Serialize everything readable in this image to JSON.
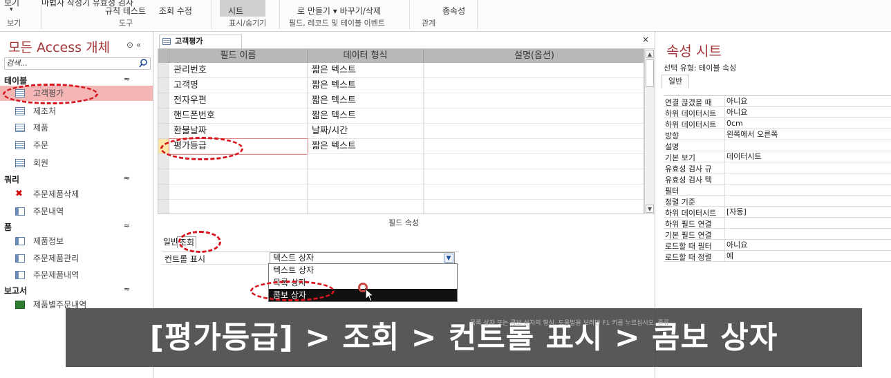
{
  "ribbon": {
    "row1": [
      "보기",
      "마법사 작성기 유효성 검사",
      "규칙 테스트",
      "조회 수정",
      "시트",
      "로 만들기 ▾ 바꾸기/삭제",
      "종속성"
    ],
    "row2_small": [
      "▾"
    ],
    "groups": [
      "보기",
      "도구",
      "표시/숨기기",
      "필드, 레코드 및 테이블 이벤트",
      "관계"
    ]
  },
  "nav": {
    "title": "모든 Access 개체",
    "title_buttons": "⊙ «",
    "search_placeholder": "검색...",
    "sections": {
      "tables": {
        "label": "테이블",
        "items": [
          "고객평가",
          "제조처",
          "제품",
          "주문",
          "회원"
        ]
      },
      "queries": {
        "label": "쿼리",
        "items": [
          "주문제품삭제",
          "주문내역"
        ]
      },
      "forms": {
        "label": "폼",
        "items": [
          "제품정보",
          "주문제품관리",
          "주문제품내역"
        ]
      },
      "reports": {
        "label": "보고서",
        "items": [
          "제품별주문내역"
        ]
      }
    },
    "collapse_glyph": "≈"
  },
  "document": {
    "tab_label": "고객평가",
    "close_glyph": "×",
    "columns": [
      "필드 이름",
      "데이터 형식",
      "설명(옵션)"
    ],
    "rows": [
      {
        "name": "관리번호",
        "type": "짧은 텍스트"
      },
      {
        "name": "고객명",
        "type": "짧은 텍스트"
      },
      {
        "name": "전자우편",
        "type": "짧은 텍스트"
      },
      {
        "name": "핸드폰번호",
        "type": "짧은 텍스트"
      },
      {
        "name": "환불날짜",
        "type": "날짜/시간"
      },
      {
        "name": "평가등급",
        "type": "짧은 텍스트"
      }
    ],
    "field_props_label": "필드 속성",
    "tabs": {
      "general": "일반",
      "lookup": "조회"
    },
    "lookup": {
      "control_label": "컨트롤 표시",
      "value": "텍스트 상자"
    },
    "dropdown_options": [
      "텍스트 상자",
      "목록 상자",
      "콤보 상자"
    ],
    "dropdown_highlight_index": 2
  },
  "property_sheet": {
    "title": "속성 시트",
    "selection_type": "선택 유형: 테이블 속성",
    "tab": "일반",
    "rows": [
      {
        "k": "연결 끊겼을 때",
        "v": "아니요"
      },
      {
        "k": "하위 데이터시트",
        "v": "아니요"
      },
      {
        "k": "하위 데이터시트",
        "v": "0cm"
      },
      {
        "k": "방향",
        "v": "왼쪽에서 오른쪽"
      },
      {
        "k": "설명",
        "v": ""
      },
      {
        "k": "기본 보기",
        "v": "데이터시트"
      },
      {
        "k": "유효성 검사 규",
        "v": ""
      },
      {
        "k": "유효성 검사 텍",
        "v": ""
      },
      {
        "k": "필터",
        "v": ""
      },
      {
        "k": "정렬 기준",
        "v": ""
      },
      {
        "k": "하위 데이터시트",
        "v": "[자동]"
      },
      {
        "k": "하위 필드 연결",
        "v": ""
      },
      {
        "k": "기본 필드 연결",
        "v": ""
      },
      {
        "k": "로드할 때 필터",
        "v": "아니요"
      },
      {
        "k": "로드할 때 정렬",
        "v": "예"
      }
    ]
  },
  "banner": {
    "text": "[평가등급] > 조회 >  컨트롤 표시 > 콤보 상자",
    "ghost_text": "목록 상자 또는 콤보 상자의 형식. 도움말을 보려면 F1 키를 누르십시오. 종류"
  },
  "colors": {
    "accent": "#a4373a",
    "annotation": "#d7151f",
    "selected_nav": "#f4b5b5"
  }
}
